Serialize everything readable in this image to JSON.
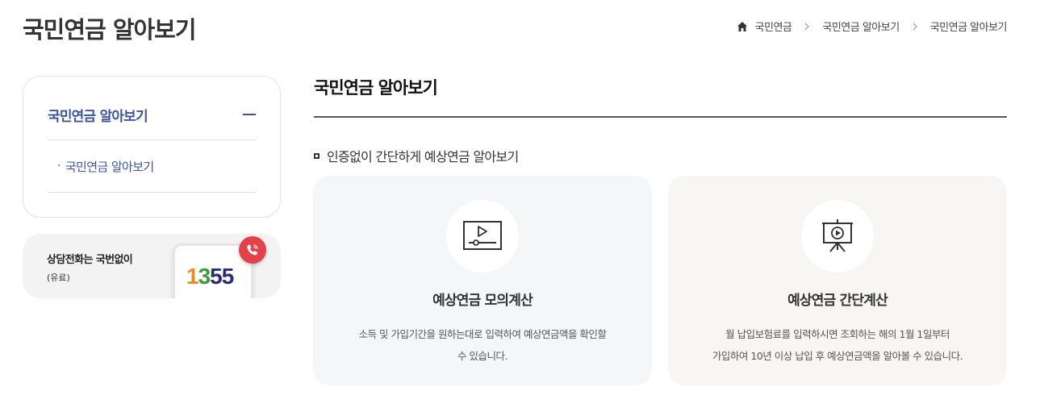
{
  "page": {
    "title": "국민연금 알아보기"
  },
  "breadcrumb": {
    "items": [
      "국민연금",
      "국민연금 알아보기",
      "국민연금 알아보기"
    ]
  },
  "side_menu": {
    "head_label": "국민연금 알아보기",
    "sub_items": [
      {
        "bullet": "·",
        "label": "국민연금 알아보기"
      }
    ]
  },
  "call_box": {
    "title": "상담전화는 국번없이",
    "sub": "(유료)",
    "number_parts": [
      "1",
      "3",
      "55"
    ]
  },
  "content": {
    "title": "국민연금 알아보기",
    "section_head": "인증없이 간단하게 예상연금 알아보기",
    "cards": [
      {
        "icon": "video-player-icon",
        "title": "예상연금 모의계산",
        "desc_lines": [
          "소득 및 가입기간을 원하는대로 입력하여 예상연금액을 확인할",
          "수 있습니다."
        ]
      },
      {
        "icon": "presentation-board-icon",
        "title": "예상연금 간단계산",
        "desc_lines": [
          "월 납입보험료를 입력하시면 조회하는 해의 1월 1일부터",
          "가입하여 10년 이상 납입 후 예상연금액을 알아볼 수 있습니다."
        ]
      }
    ]
  },
  "colors": {
    "accent": "#3c54a4",
    "call_icon_bg": "#e5414a"
  }
}
